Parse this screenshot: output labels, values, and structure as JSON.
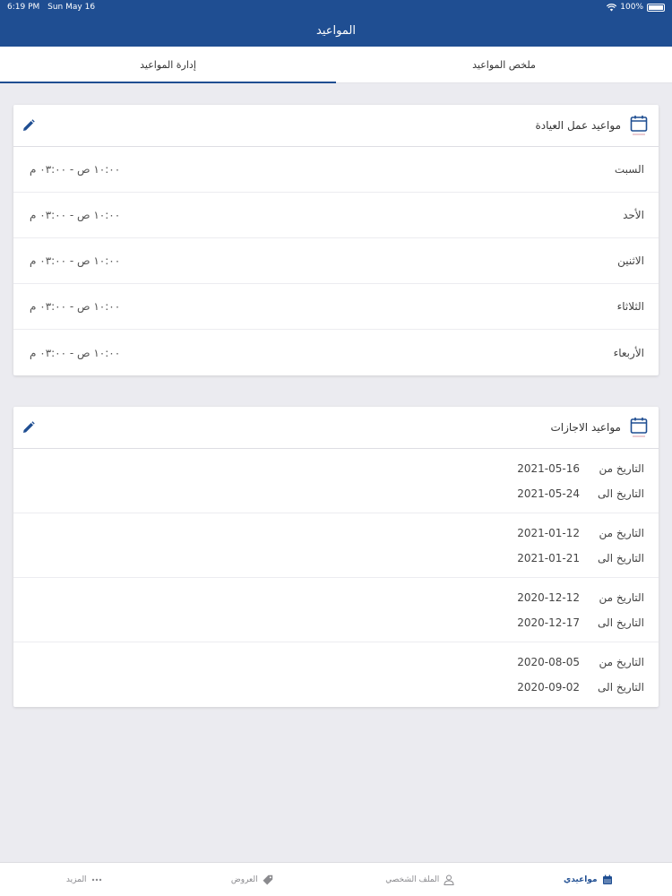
{
  "status": {
    "time": "6:19 PM",
    "date": "Sun May 16",
    "battery": "100%"
  },
  "nav": {
    "title": "المواعيد"
  },
  "tabs": [
    {
      "label": "ملخص المواعيد",
      "active": false
    },
    {
      "label": "إدارة المواعيد",
      "active": true
    }
  ],
  "work_hours": {
    "title": "مواعيد عمل العيادة",
    "days": [
      {
        "day": "السبت",
        "time": "١٠:٠٠ ص - ٠٣:٠٠ م"
      },
      {
        "day": "الأحد",
        "time": "١٠:٠٠ ص - ٠٣:٠٠ م"
      },
      {
        "day": "الاثنين",
        "time": "١٠:٠٠ ص - ٠٣:٠٠ م"
      },
      {
        "day": "الثلاثاء",
        "time": "١٠:٠٠ ص - ٠٣:٠٠ م"
      },
      {
        "day": "الأربعاء",
        "time": "١٠:٠٠ ص - ٠٣:٠٠ م"
      }
    ]
  },
  "vacations": {
    "title": "مواعيد الاجازات",
    "from_label": "التاريخ من",
    "to_label": "التاريخ الى",
    "items": [
      {
        "from": "2021-05-16",
        "to": "2021-05-24"
      },
      {
        "from": "2021-01-12",
        "to": "2021-01-21"
      },
      {
        "from": "2020-12-12",
        "to": "2020-12-17"
      },
      {
        "from": "2020-08-05",
        "to": "2020-09-02"
      }
    ]
  },
  "bottom_nav": [
    {
      "label": "مواعيدي",
      "icon": "calendar-icon",
      "active": true
    },
    {
      "label": "الملف الشخصي",
      "icon": "person-icon",
      "active": false
    },
    {
      "label": "العروض",
      "icon": "tag-icon",
      "active": false
    },
    {
      "label": "المزيد",
      "icon": "more-icon",
      "active": false
    }
  ],
  "colors": {
    "primary": "#1f4e92",
    "background": "#ebebf0"
  }
}
